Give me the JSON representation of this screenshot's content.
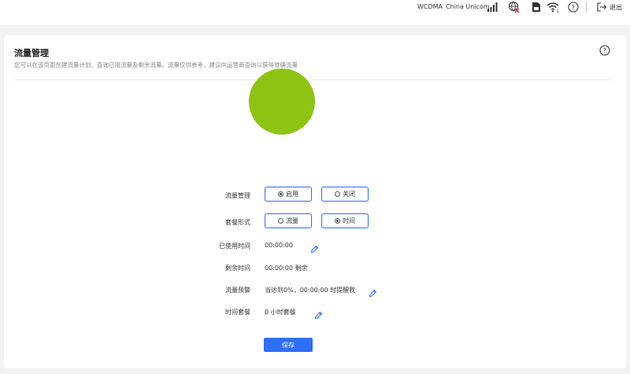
{
  "topbar": {
    "network_type": "WCDMA",
    "carrier": "China Unicom",
    "logout_label": "退出"
  },
  "page": {
    "title": "流量管理",
    "description": "您可以在该页面创建流量计划、查询已用流量及剩余流量。流量仅供参考，建议向运营商查询以获得准确流量"
  },
  "form": {
    "flow_mgmt_label": "流量管理",
    "flow_mgmt_options": [
      "启用",
      "关闭"
    ],
    "flow_mgmt_selected": "启用",
    "package_form_label": "套餐形式",
    "package_form_options": [
      "流量",
      "时间"
    ],
    "package_form_selected": "时间",
    "used_time_label": "已使用时间",
    "used_time_value": "00:00:00",
    "remaining_time_label": "剩余时间",
    "remaining_time_value": "00:00:00 剩余",
    "alert_label": "流量预警",
    "alert_value": "当达到0%，00:00:00 时提醒我",
    "time_package_label": "时间套餐",
    "time_package_value": "0 小时套餐",
    "save_label": "保存"
  },
  "chart_data": {
    "type": "pie",
    "values": [
      100
    ],
    "colors": [
      "#8dc414"
    ]
  },
  "colors": {
    "accent": "#2f6ef5",
    "pie_fill": "#8dc414"
  }
}
